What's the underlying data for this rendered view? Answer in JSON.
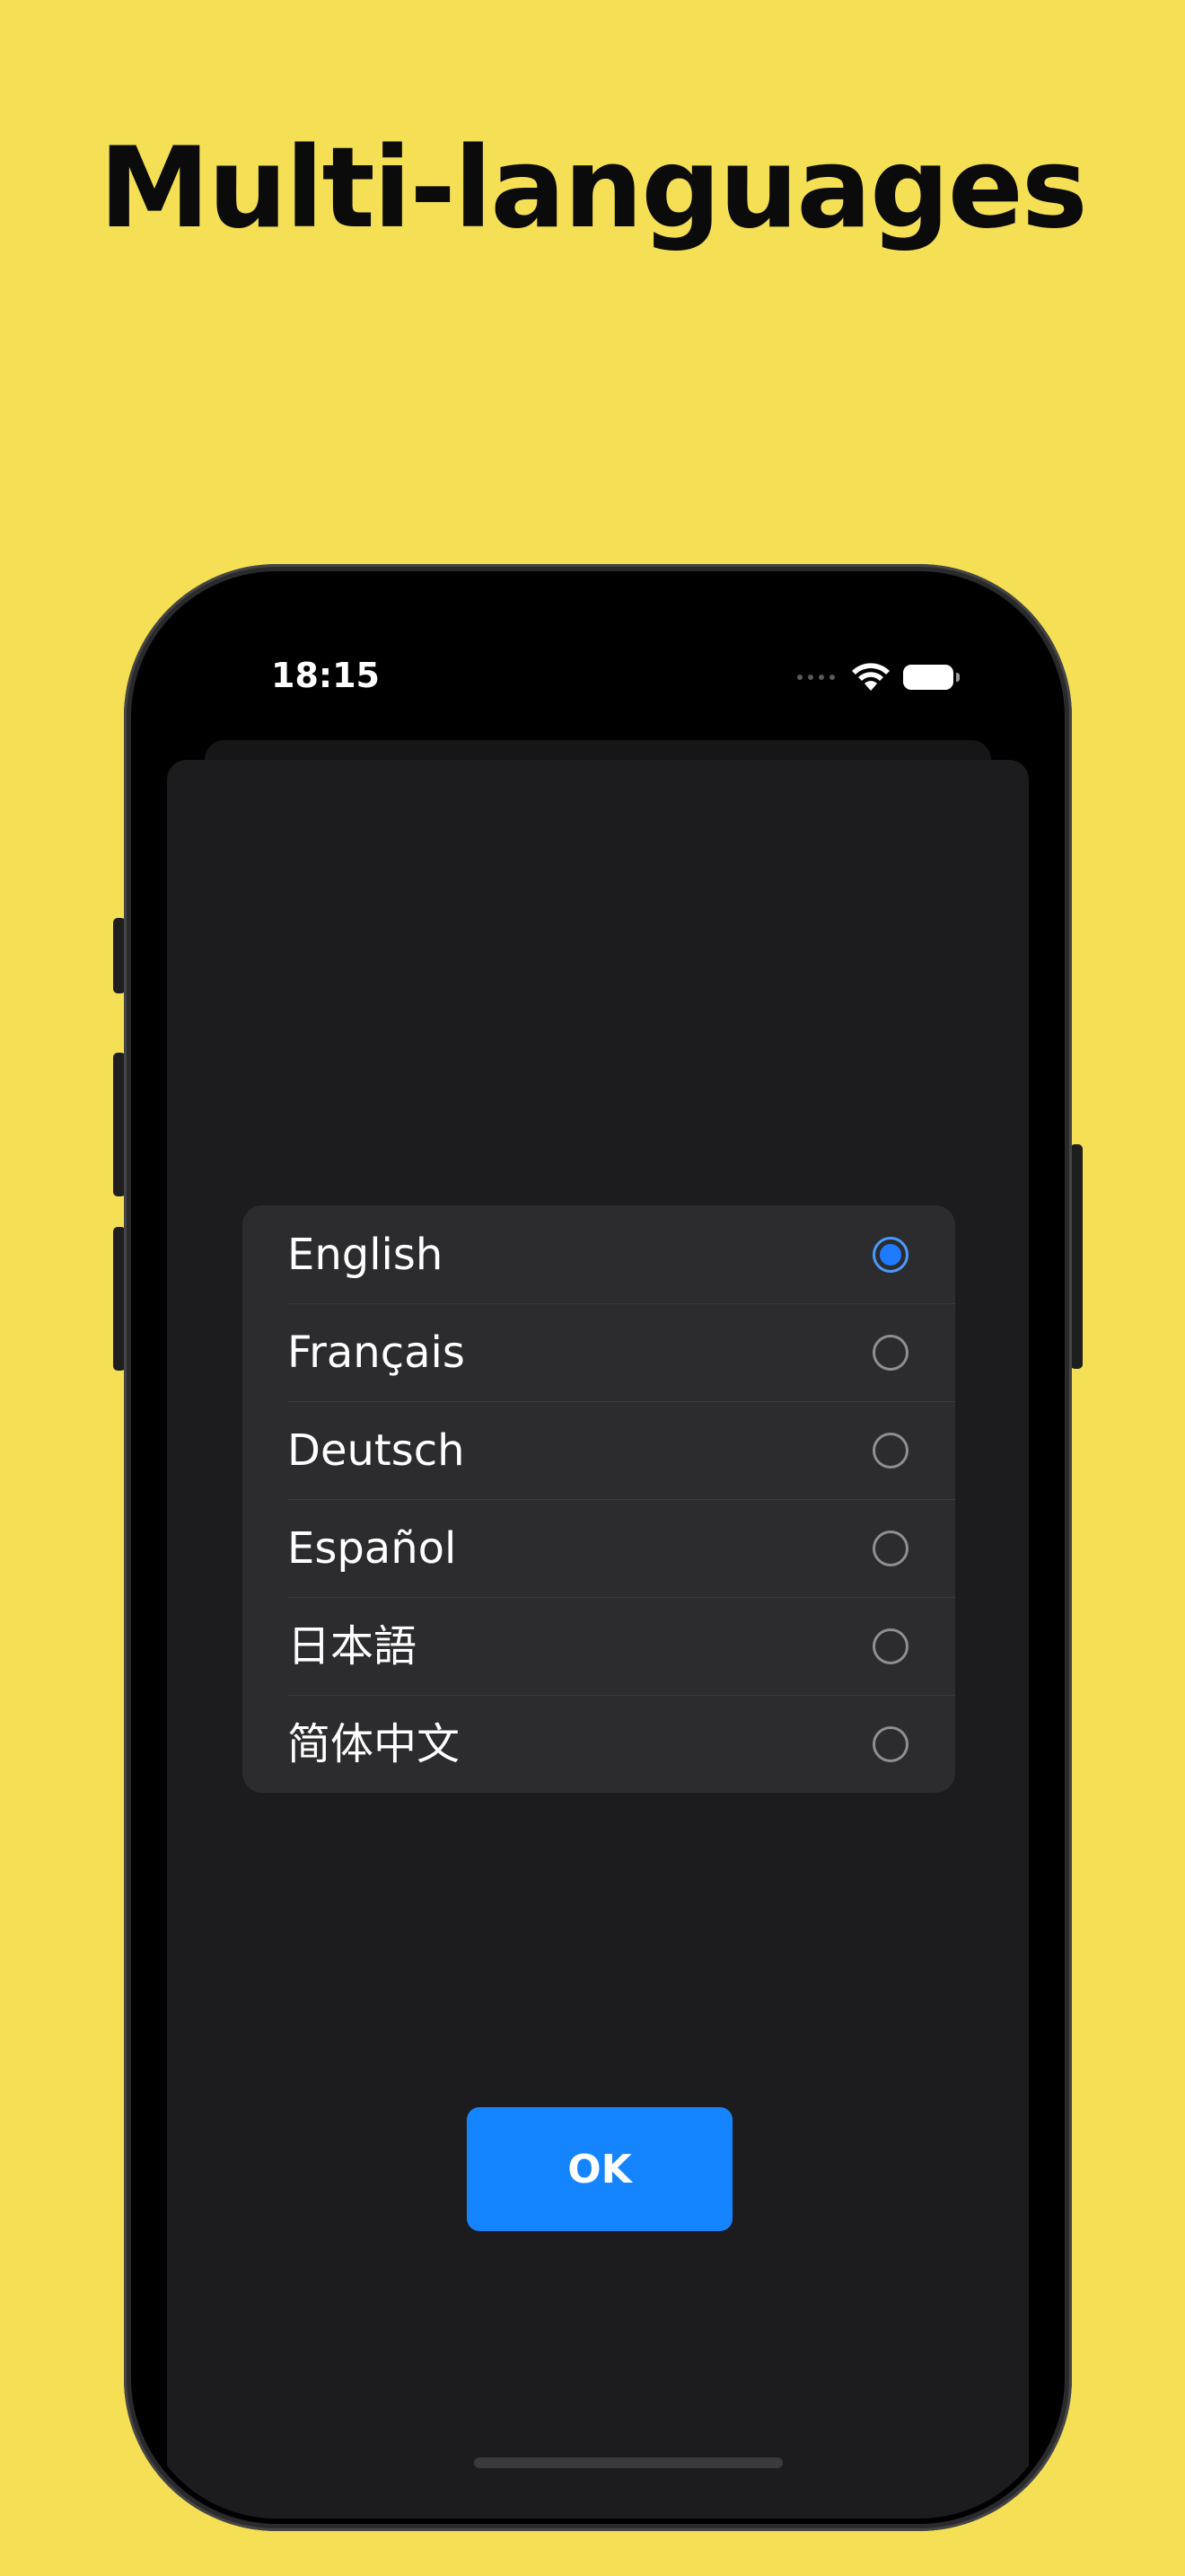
{
  "headline": "Multi-languages",
  "status_bar": {
    "time": "18:15",
    "icons": [
      "signal-dots-icon",
      "wifi-icon",
      "battery-icon"
    ]
  },
  "language_picker": {
    "items": [
      {
        "label": "English",
        "selected": true
      },
      {
        "label": "Français",
        "selected": false
      },
      {
        "label": "Deutsch",
        "selected": false
      },
      {
        "label": "Español",
        "selected": false
      },
      {
        "label": "日本語",
        "selected": false
      },
      {
        "label": "简体中文",
        "selected": false
      }
    ]
  },
  "ok_button": {
    "label": "OK"
  },
  "colors": {
    "background": "#F4DF55",
    "accent": "#1485FF",
    "sheet": "#1C1C1E",
    "list": "#2C2C2E"
  }
}
